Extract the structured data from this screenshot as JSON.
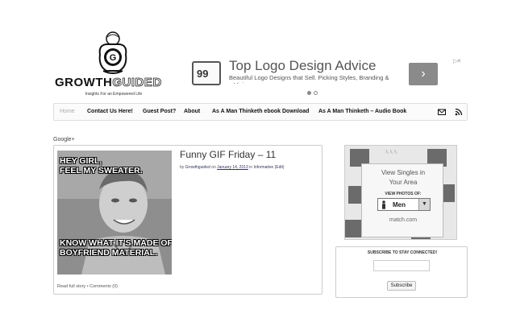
{
  "logo": {
    "word_primary": "GROWTH",
    "word_secondary": "GUIDED",
    "tagline": "Insights For an Empowered Life",
    "emblem": "G"
  },
  "ad": {
    "badge": "99",
    "title": "Top Logo Design Advice",
    "description": "Beautiful Logo Designs that Sell. Picking Styles, Branding & a Vision",
    "next_icon": "chevron-right-icon",
    "close_label": "▷✕"
  },
  "nav": {
    "items": [
      "Home",
      "Contact Us Here!",
      "Guest Post?",
      "About",
      "As A Man Thinketh ebook Download",
      "As A Man Thinketh – Audio Book"
    ],
    "icons": [
      "mail-icon",
      "rss-icon"
    ]
  },
  "gplus": "Google+",
  "post": {
    "title": "Funny GIF Friday – 11",
    "meta_by": "by",
    "author": "Growthguided",
    "meta_on": "on",
    "date": "January 14, 2013",
    "meta_in": "in",
    "category": "Informative",
    "edit": "(Edit)",
    "meme_top": [
      "HEY GIRL,",
      "FEEL MY SWEATER."
    ],
    "meme_bottom": [
      "KNOW WHAT IT'S MADE OF?",
      "BOYFRIEND MATERIAL."
    ],
    "read_more": "Read full story",
    "separator": "•",
    "comments": "Comments (0)"
  },
  "match_ad": {
    "line1": "View Singles in",
    "line2": "Your Area",
    "view_photos": "VIEW PHOTOS OF:",
    "selected": "Men",
    "brand": "match.com"
  },
  "subscribe": {
    "heading": "SUBSCRIBE TO STAY CONNECTED!",
    "email_value": "",
    "button": "Subscribe"
  }
}
